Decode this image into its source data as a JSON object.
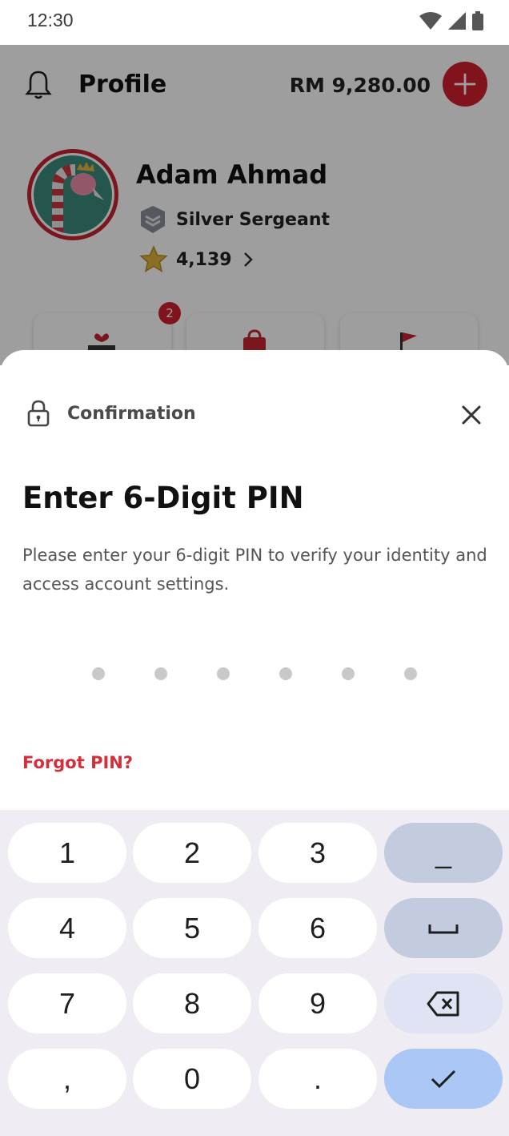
{
  "status_bar": {
    "time": "12:30"
  },
  "header": {
    "title": "Profile",
    "balance": "RM 9,280.00"
  },
  "profile": {
    "name": "Adam Ahmad",
    "rank": "Silver Sergeant",
    "points": "4,139"
  },
  "shortcuts": {
    "badge_count": "2"
  },
  "sheet": {
    "header_label": "Confirmation",
    "title": "Enter 6-Digit PIN",
    "description": "Please enter your 6-digit PIN to verify your identity and access account settings.",
    "pin_length": 6,
    "forgot_label": "Forgot PIN?"
  },
  "keyboard": {
    "keys": [
      "1",
      "2",
      "3",
      "4",
      "5",
      "6",
      "7",
      "8",
      "9",
      ",",
      "0",
      "."
    ],
    "side_keys": {
      "underscore": "_",
      "space": "space-icon",
      "backspace": "backspace-icon",
      "enter": "check-icon"
    }
  },
  "colors": {
    "brand_red": "#d0202f",
    "link_red": "#d32f3c",
    "keyboard_bg": "#efedf3",
    "enter_key": "#abc7f5"
  }
}
